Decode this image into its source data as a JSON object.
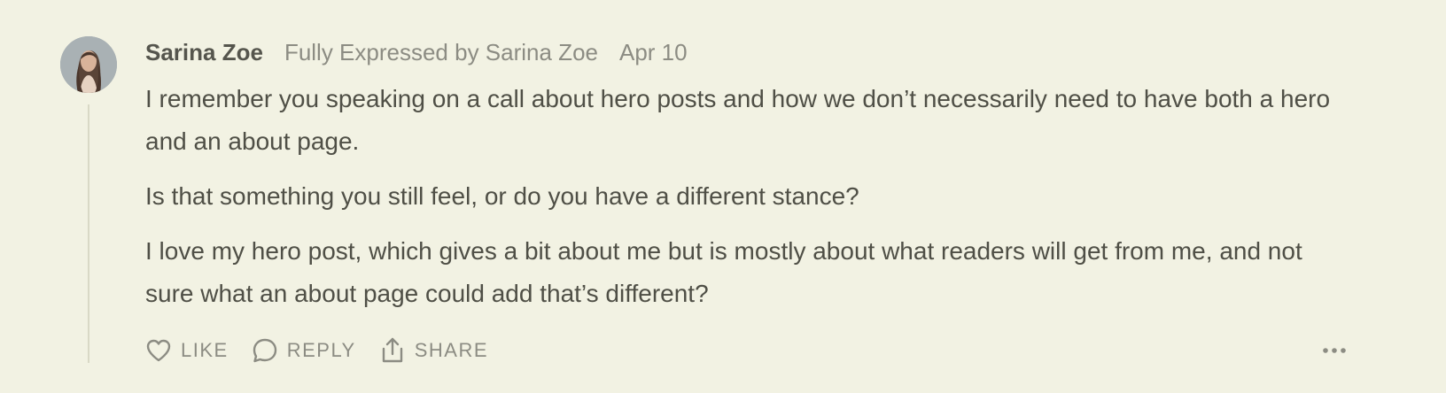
{
  "comment": {
    "author": "Sarina Zoe",
    "publication": "Fully Expressed by Sarina Zoe",
    "date": "Apr 10",
    "paragraphs": [
      "I remember you speaking on a call about hero posts and how we don’t necessarily need to have both a hero and an about page.",
      "Is that something you still feel, or do you have a different stance?",
      "I love my hero post, which gives a bit about me but is mostly about what readers will get from me, and not sure what an about page could add that’s different?"
    ]
  },
  "actions": {
    "like_label": "LIKE",
    "reply_label": "REPLY",
    "share_label": "SHARE"
  },
  "icons": {
    "like": "heart-icon",
    "reply": "speech-bubble-icon",
    "share": "share-upload-icon",
    "more": "more-horizontal-icon"
  },
  "colors": {
    "background": "#f2f2e3",
    "text": "#4f4f46",
    "muted": "#8c8c83",
    "thread_line": "#d9d9c6"
  }
}
